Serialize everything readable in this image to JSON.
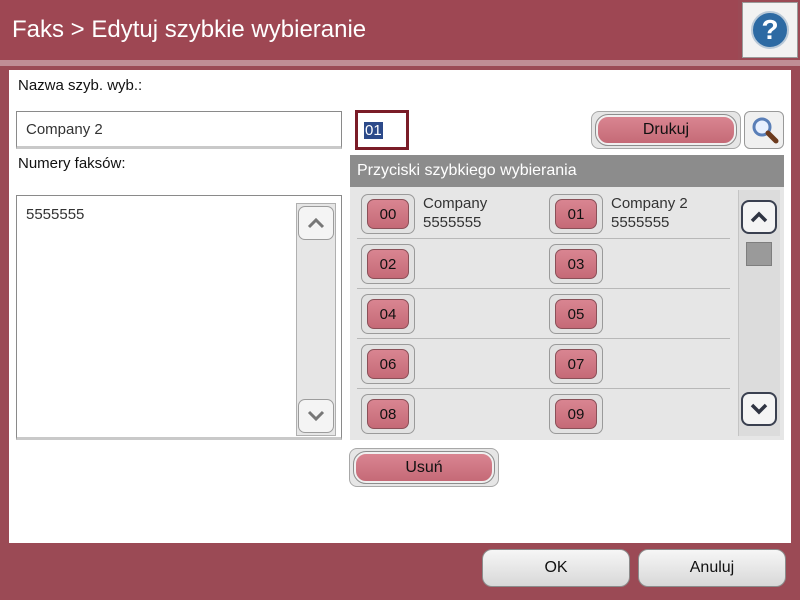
{
  "header": {
    "title": "Faks > Edytuj szybkie wybieranie",
    "help_label": "?"
  },
  "form": {
    "name_label": "Nazwa szyb. wyb.:",
    "name_value": "Company 2",
    "number_value": "01",
    "fax_numbers_label": "Numery faksów:",
    "fax_numbers": [
      "5555555"
    ],
    "print_label": "Drukuj",
    "delete_label": "Usuń"
  },
  "speed_dial": {
    "title": "Przyciski szybkiego wybierania",
    "buttons": [
      {
        "code": "00",
        "name": "Company",
        "number": "5555555"
      },
      {
        "code": "01",
        "name": "Company 2",
        "number": "5555555"
      },
      {
        "code": "02",
        "name": "",
        "number": ""
      },
      {
        "code": "03",
        "name": "",
        "number": ""
      },
      {
        "code": "04",
        "name": "",
        "number": ""
      },
      {
        "code": "05",
        "name": "",
        "number": ""
      },
      {
        "code": "06",
        "name": "",
        "number": ""
      },
      {
        "code": "07",
        "name": "",
        "number": ""
      },
      {
        "code": "08",
        "name": "",
        "number": ""
      },
      {
        "code": "09",
        "name": "",
        "number": ""
      }
    ]
  },
  "footer": {
    "ok_label": "OK",
    "cancel_label": "Anuluj"
  },
  "colors": {
    "accent": "#9e4753",
    "button_pink": "#cf7682",
    "selection": "#2c4a8a"
  }
}
